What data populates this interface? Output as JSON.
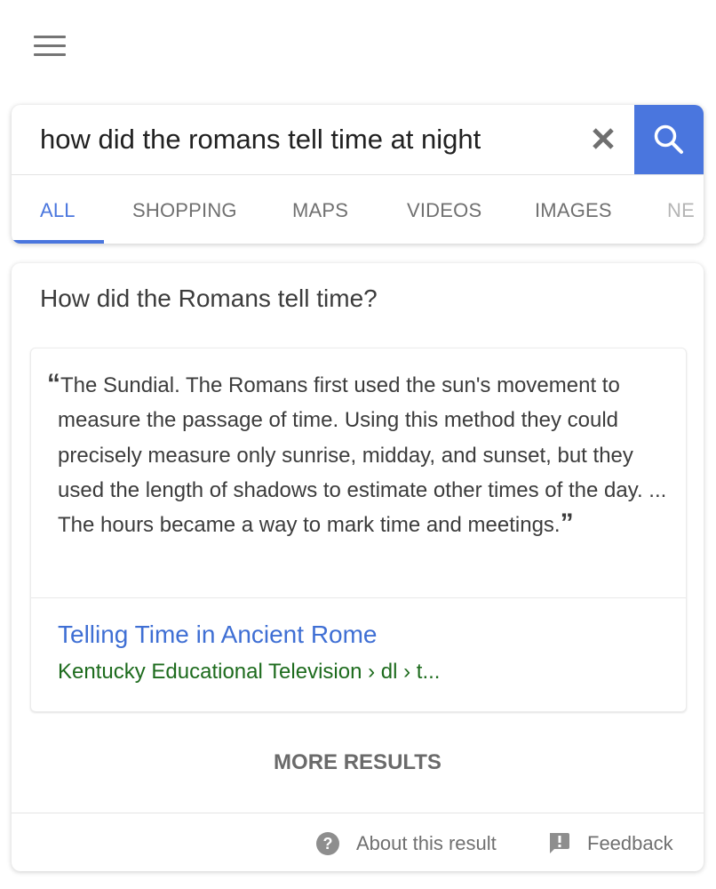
{
  "header": {
    "menu_icon": "hamburger-menu-icon"
  },
  "search": {
    "query": "how did the romans tell time at night",
    "clear_icon": "close-icon",
    "search_icon": "search-icon",
    "accent_color": "#4a76de"
  },
  "tabs": [
    {
      "label": "ALL",
      "active": true
    },
    {
      "label": "SHOPPING",
      "active": false
    },
    {
      "label": "MAPS",
      "active": false
    },
    {
      "label": "VIDEOS",
      "active": false
    },
    {
      "label": "IMAGES",
      "active": false
    },
    {
      "label": "NEWS",
      "active": false,
      "truncated_display": "NE"
    }
  ],
  "result": {
    "question": "How did the Romans tell time?",
    "open_quote": "“",
    "snippet": "The Sundial. The Romans first used the sun's movement to measure the passage of time. Using this method they could precisely measure only sunrise, midday, and sunset, but they used the length of shadows to estimate other times of the day. ... The hours became a way to mark time and meetings.",
    "close_quote": "”",
    "source_title": "Telling Time in Ancient Rome",
    "source_breadcrumb": "Kentucky Educational Television › dl › t...",
    "link_color": "#3f6fd4",
    "breadcrumb_color": "#1d6b1d",
    "more_results_label": "MORE RESULTS"
  },
  "footer": {
    "about_label": "About this result",
    "about_icon": "help-circle-icon",
    "feedback_label": "Feedback",
    "feedback_icon": "feedback-icon"
  }
}
